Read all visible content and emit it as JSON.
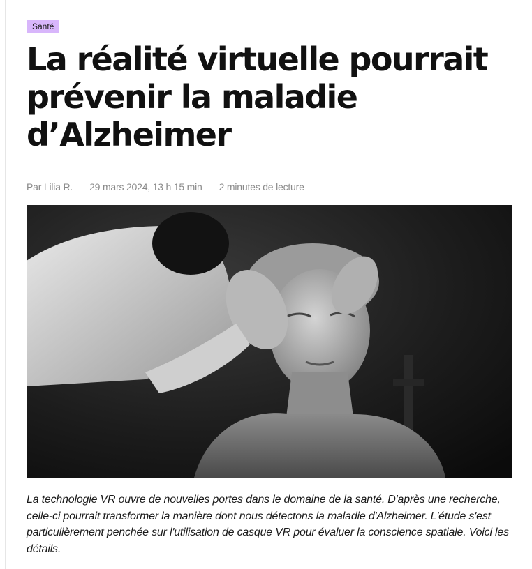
{
  "article": {
    "category_tag": "Santé",
    "title": "La réalité virtuelle pourrait prévenir la maladie d’Alzheimer",
    "meta": {
      "author": "Par Lilia R.",
      "date": "29 mars 2024, 13 h 15 min",
      "reading_time": "2 minutes de lecture"
    },
    "lead": "La technologie VR ouvre de nouvelles portes dans le domaine de la santé. D'après une recherche, celle-ci pourrait transformer la manière dont nous détectons la maladie d'Alzheimer. L'étude s'est particulièrement penchée sur l'utilisation de casque VR pour évaluer la conscience spatiale. Voici les détails."
  },
  "colors": {
    "tag_background": "#d8b6fb",
    "meta_text": "#8a8a8a",
    "divider": "#e4e4e4"
  }
}
